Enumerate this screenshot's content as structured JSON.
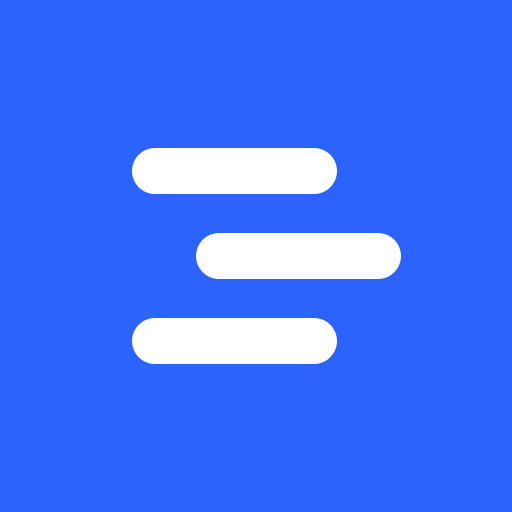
{
  "icon": {
    "name": "app-logo-icon",
    "background_color": "#2b63fb",
    "bar_color": "#ffffff"
  }
}
